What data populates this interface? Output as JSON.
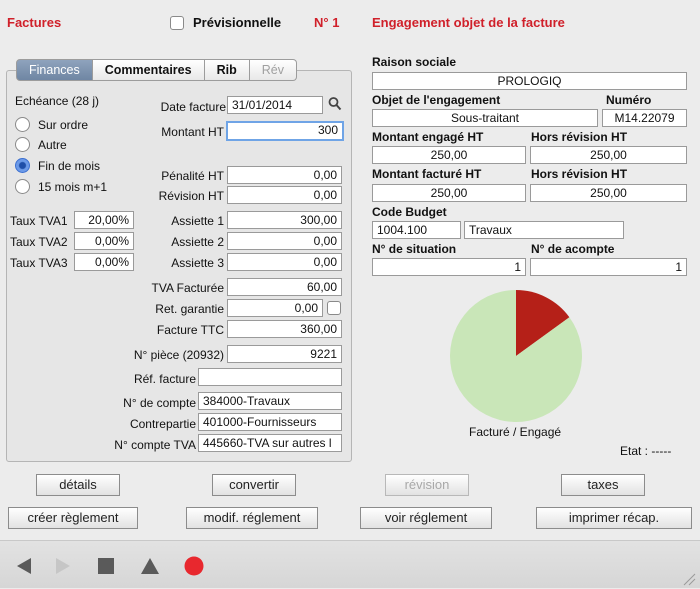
{
  "header": {
    "title": "Factures",
    "previsionnelle_label": "Prévisionnelle",
    "number": "N° 1",
    "engagement_title": "Engagement objet de la facture"
  },
  "tabs": [
    {
      "label": "Finances",
      "state": "active"
    },
    {
      "label": "Commentaires",
      "state": "normal"
    },
    {
      "label": "Rib",
      "state": "normal"
    },
    {
      "label": "Rév",
      "state": "disabled"
    }
  ],
  "finances": {
    "echeance_label": "Echéance (28 j)",
    "radio_options": [
      {
        "label": "Sur ordre",
        "selected": false
      },
      {
        "label": "Autre",
        "selected": false
      },
      {
        "label": "Fin de mois",
        "selected": true
      },
      {
        "label": "15 mois m+1",
        "selected": false
      }
    ],
    "date_facture_label": "Date facture",
    "date_facture": "31/01/2014",
    "montant_ht_label": "Montant HT",
    "montant_ht": "300",
    "penalite_ht_label": "Pénalité HT",
    "penalite_ht": "0,00",
    "revision_ht_label": "Révision HT",
    "revision_ht": "0,00",
    "tva_rows": [
      {
        "label": "Taux TVA1",
        "rate": "20,00%",
        "assiette_label": "Assiette 1",
        "assiette": "300,00"
      },
      {
        "label": "Taux TVA2",
        "rate": "0,00%",
        "assiette_label": "Assiette 2",
        "assiette": "0,00"
      },
      {
        "label": "Taux TVA3",
        "rate": "0,00%",
        "assiette_label": "Assiette 3",
        "assiette": "0,00"
      }
    ],
    "tva_facturee_label": "TVA Facturée",
    "tva_facturee": "60,00",
    "ret_garantie_label": "Ret. garantie",
    "ret_garantie": "0,00",
    "facture_ttc_label": "Facture TTC",
    "facture_ttc": "360,00",
    "num_piece_label": "N° pièce (20932)",
    "num_piece": "9221",
    "ref_facture_label": "Réf. facture",
    "ref_facture": "",
    "num_compte_label": "N° de compte",
    "num_compte": "384000-Travaux",
    "contrepartie_label": "Contrepartie",
    "contrepartie": "401000-Fournisseurs",
    "num_compte_tva_label": "N° compte  TVA",
    "num_compte_tva": "445660-TVA sur autres l"
  },
  "engagement": {
    "raison_sociale_label": "Raison sociale",
    "raison_sociale": "PROLOGIQ",
    "objet_label": "Objet de l'engagement",
    "objet": "Sous-traitant",
    "numero_label": "Numéro",
    "numero": "M14.22079",
    "montant_engage_label": "Montant engagé HT",
    "montant_engage": "250,00",
    "hors_revision_label": "Hors révision HT",
    "hors_revision": "250,00",
    "montant_facture_label": "Montant facturé HT",
    "montant_facture": "250,00",
    "hors_revision2_label": "Hors révision HT",
    "hors_revision2": "250,00",
    "code_budget_label": "Code Budget",
    "code_budget": "1004.100",
    "code_budget_name": "Travaux",
    "situation_label": "N° de situation",
    "situation": "1",
    "acompte_label": "N° de acompte",
    "acompte": "1",
    "pie_label": "Facturé / Engagé",
    "etat_label": "Etat : -----"
  },
  "chart_data": {
    "type": "pie",
    "slices": [
      {
        "value": 15,
        "color": "#b52018"
      },
      {
        "value": 85,
        "color": "#c9e6b8"
      }
    ]
  },
  "buttons": {
    "details": "détails",
    "convertir": "convertir",
    "revision": "révision",
    "taxes": "taxes",
    "creer_reglement": "créer règlement",
    "modif_reglement": "modif. réglement",
    "voir_reglement": "voir réglement",
    "imprimer_recap": "imprimer récap."
  },
  "colors": {
    "accent_red": "#d0202a",
    "record_red": "#e8282e"
  }
}
